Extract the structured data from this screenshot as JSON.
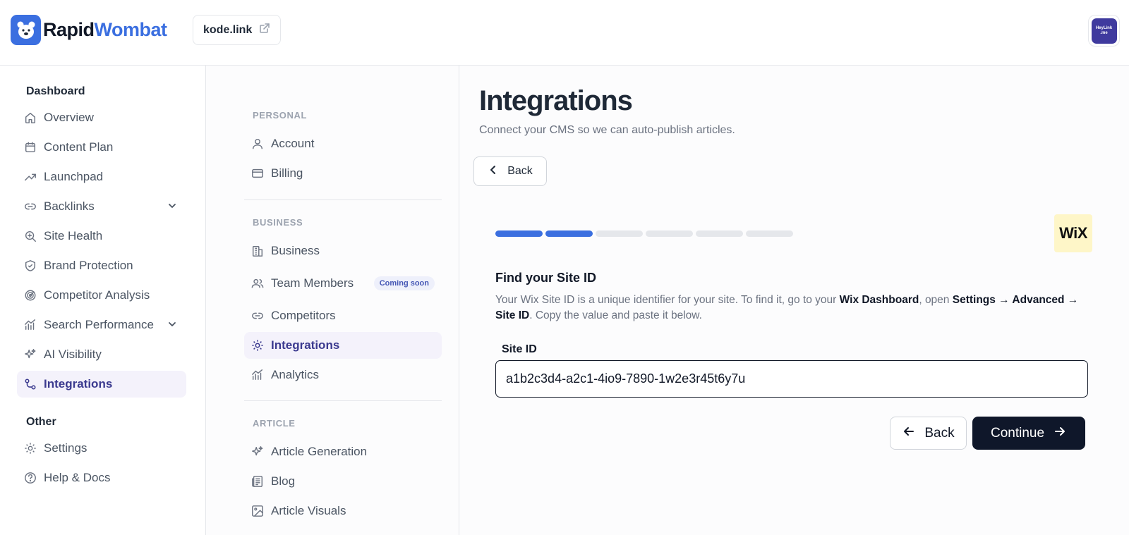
{
  "brand": {
    "name_part1": "Rapid",
    "name_part2": "Wombat"
  },
  "site": {
    "domain": "kode.link"
  },
  "avatar": {
    "line1": "HeyLink",
    "line2": ".me"
  },
  "sidebar": {
    "section_dashboard": "Dashboard",
    "items": [
      {
        "label": "Overview",
        "icon": "home-icon"
      },
      {
        "label": "Content Plan",
        "icon": "calendar-icon"
      },
      {
        "label": "Launchpad",
        "icon": "trending-up-icon"
      },
      {
        "label": "Backlinks",
        "icon": "link-icon",
        "expandable": true
      },
      {
        "label": "Site Health",
        "icon": "search-health-icon"
      },
      {
        "label": "Brand Protection",
        "icon": "shield-icon"
      },
      {
        "label": "Competitor Analysis",
        "icon": "radar-icon"
      },
      {
        "label": "Search Performance",
        "icon": "chart-icon",
        "expandable": true
      },
      {
        "label": "AI Visibility",
        "icon": "sparkles-icon"
      },
      {
        "label": "Integrations",
        "icon": "integrations-icon",
        "active": true
      }
    ],
    "section_other": "Other",
    "other_items": [
      {
        "label": "Settings",
        "icon": "gear-icon"
      },
      {
        "label": "Help & Docs",
        "icon": "help-icon"
      }
    ]
  },
  "subnav": {
    "personal_title": "PERSONAL",
    "personal": [
      {
        "label": "Account",
        "icon": "user-icon"
      },
      {
        "label": "Billing",
        "icon": "credit-card-icon"
      }
    ],
    "business_title": "BUSINESS",
    "business": [
      {
        "label": "Business",
        "icon": "building-icon"
      },
      {
        "label": "Team Members",
        "icon": "users-icon",
        "badge": "Coming soon"
      },
      {
        "label": "Competitors",
        "icon": "link-icon"
      },
      {
        "label": "Integrations",
        "icon": "gear-icon",
        "active": true
      },
      {
        "label": "Analytics",
        "icon": "chart-icon"
      }
    ],
    "article_title": "ARTICLE",
    "article": [
      {
        "label": "Article Generation",
        "icon": "sparkles-icon"
      },
      {
        "label": "Blog",
        "icon": "newspaper-icon"
      },
      {
        "label": "Article Visuals",
        "icon": "image-icon"
      }
    ]
  },
  "content": {
    "title": "Integrations",
    "subtitle": "Connect your CMS so we can auto-publish articles.",
    "back_top": "Back",
    "progress": {
      "total_steps": 6,
      "completed_steps": 2
    },
    "cms_logo": "WiX",
    "step_title": "Find your Site ID",
    "desc": {
      "p1": "Your Wix Site ID is a unique identifier for your site. To find it, go to your ",
      "b1": "Wix Dashboard",
      "p2": ", open ",
      "b2": "Settings → Advanced → Site ID",
      "p3": ". Copy the value and paste it below."
    },
    "field_label": "Site ID",
    "field_value": "a1b2c3d4-a2c1-4io9-7890-1w2e3r45t6y7u",
    "back_button": "Back",
    "continue_button": "Continue"
  },
  "colors": {
    "accent": "#3b6fe0",
    "active_bg": "#f4f2fb",
    "active_text": "#3b3a8f",
    "dark_button": "#0f172a"
  }
}
